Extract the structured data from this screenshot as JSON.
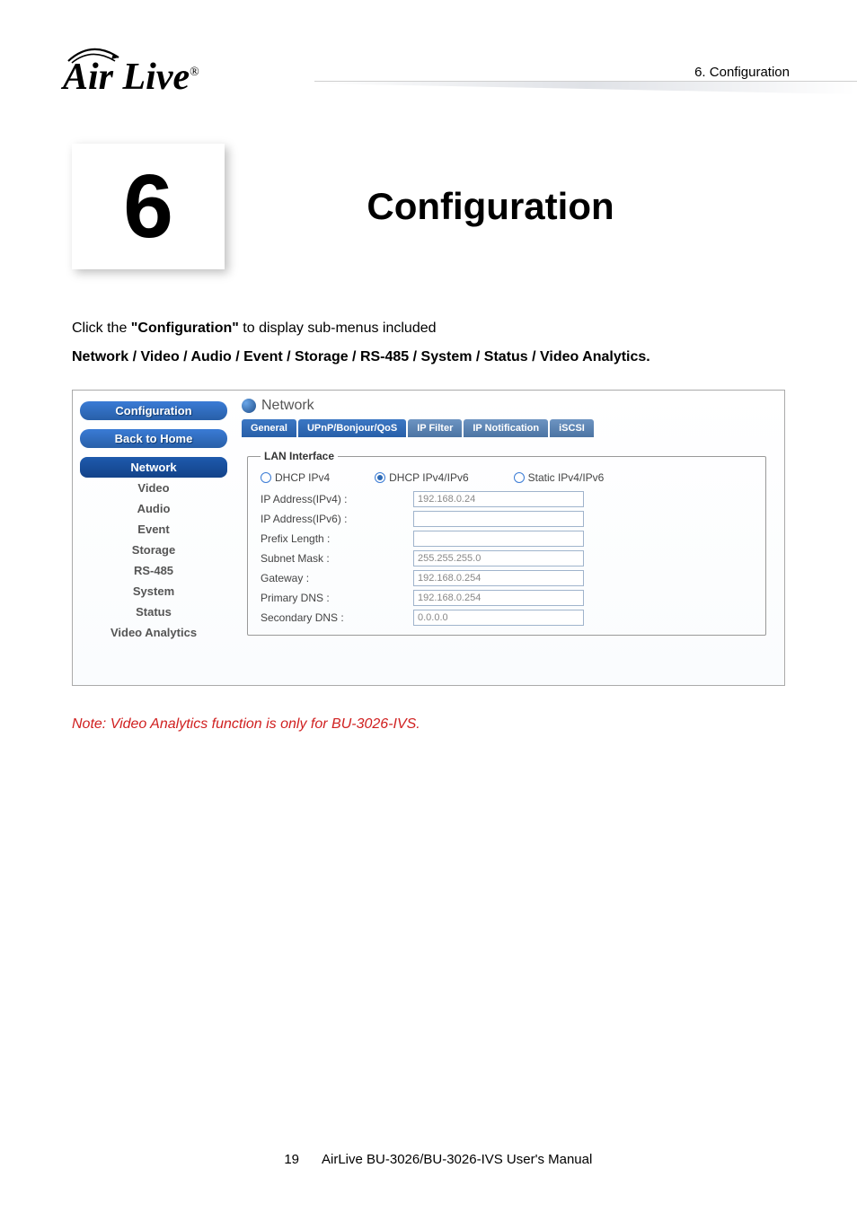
{
  "header": {
    "logo_text": "Air Live",
    "breadcrumb": "6.  Configuration"
  },
  "chapter": {
    "number": "6",
    "title": "Configuration"
  },
  "intro": {
    "line1_pre": "Click the ",
    "line1_bold": "\"Configuration\"",
    "line1_post": " to display sub-menus included",
    "line2": "Network / Video / Audio / Event / Storage / RS-485 / System / Status / Video Analytics."
  },
  "screenshot": {
    "side": {
      "title": "Configuration",
      "back": "Back to Home",
      "items": [
        "Network",
        "Video",
        "Audio",
        "Event",
        "Storage",
        "RS-485",
        "System",
        "Status",
        "Video Analytics"
      ]
    },
    "main": {
      "title": "Network",
      "tabs": [
        "General",
        "UPnP/Bonjour/QoS",
        "IP Filter",
        "IP Notification",
        "iSCSI"
      ],
      "fieldset_legend": "LAN Interface",
      "radios": [
        {
          "label": "DHCP IPv4",
          "checked": false
        },
        {
          "label": "DHCP IPv4/IPv6",
          "checked": true
        },
        {
          "label": "Static IPv4/IPv6",
          "checked": false
        }
      ],
      "rows": [
        {
          "label": "IP Address(IPv4) :",
          "value": "192.168.0.24"
        },
        {
          "label": "IP Address(IPv6) :",
          "value": ""
        },
        {
          "label": "Prefix Length :",
          "value": ""
        },
        {
          "label": "Subnet Mask :",
          "value": "255.255.255.0"
        },
        {
          "label": "Gateway :",
          "value": "192.168.0.254"
        },
        {
          "label": "Primary DNS :",
          "value": "192.168.0.254"
        },
        {
          "label": "Secondary DNS :",
          "value": "0.0.0.0"
        }
      ]
    }
  },
  "note": "Note: Video Analytics function is only for BU-3026-IVS.",
  "footer": {
    "page": "19",
    "manual": "AirLive  BU-3026/BU-3026-IVS  User's  Manual"
  }
}
